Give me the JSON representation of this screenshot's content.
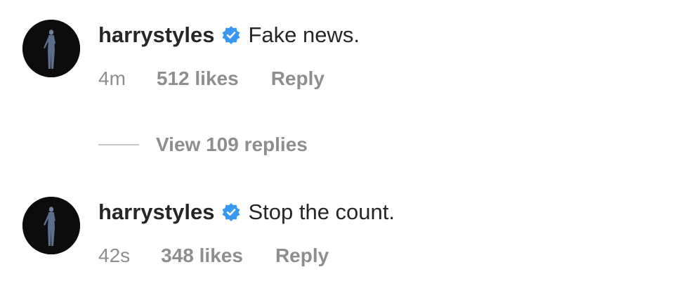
{
  "comments": [
    {
      "username": "harrystyles",
      "text": "Fake news.",
      "time": "4m",
      "likes": "512 likes",
      "reply": "Reply",
      "verified": true,
      "avatar_icon": "profile-photo"
    },
    {
      "username": "harrystyles",
      "text": "Stop the count.",
      "time": "42s",
      "likes": "348 likes",
      "reply": "Reply",
      "verified": true,
      "avatar_icon": "profile-photo"
    }
  ],
  "view_replies": "View 109 replies",
  "colors": {
    "text": "#262626",
    "meta": "#8e8e8e",
    "verified": "#3897f0",
    "avatar_bg": "#0c0c0c"
  }
}
